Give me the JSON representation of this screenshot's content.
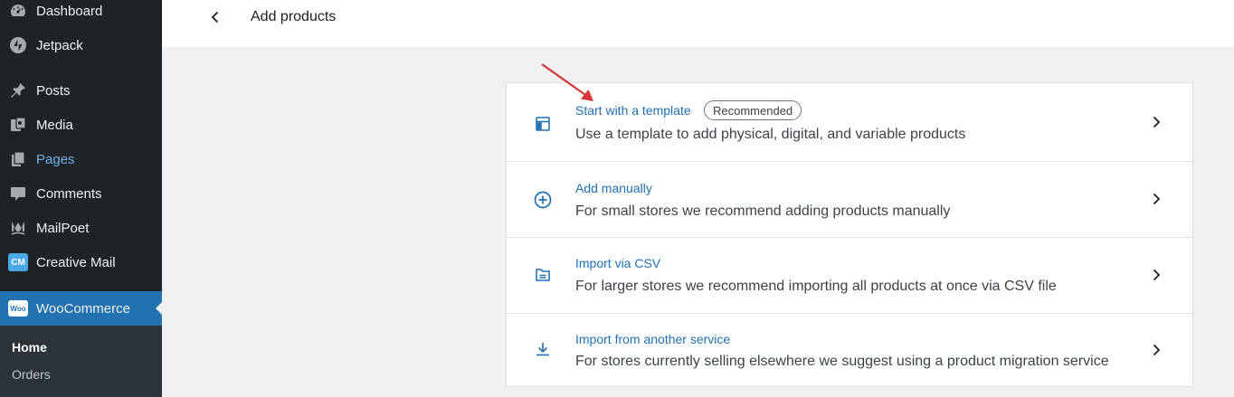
{
  "sidebar": {
    "items": [
      {
        "label": "Dashboard",
        "icon": "dashboard-icon"
      },
      {
        "label": "Jetpack",
        "icon": "jetpack-icon"
      },
      {
        "label": "Posts",
        "icon": "pin-icon"
      },
      {
        "label": "Media",
        "icon": "media-icon"
      },
      {
        "label": "Pages",
        "icon": "pages-icon"
      },
      {
        "label": "Comments",
        "icon": "comment-icon"
      },
      {
        "label": "MailPoet",
        "icon": "mailpoet-icon"
      },
      {
        "label": "Creative Mail",
        "icon": "creative-mail-icon",
        "badge": "CM"
      },
      {
        "label": "WooCommerce",
        "icon": "woocommerce-icon",
        "badge": "Woo"
      }
    ],
    "submenu": [
      {
        "label": "Home"
      },
      {
        "label": "Orders"
      }
    ]
  },
  "header": {
    "title": "Add products"
  },
  "options": [
    {
      "title": "Start with a template",
      "badge": "Recommended",
      "description": "Use a template to add physical, digital, and variable products",
      "icon": "layout-template-icon"
    },
    {
      "title": "Add manually",
      "description": "For small stores we recommend adding products manually",
      "icon": "plus-circle-icon"
    },
    {
      "title": "Import via CSV",
      "description": "For larger stores we recommend importing all products at once via CSV file",
      "icon": "csv-file-icon"
    },
    {
      "title": "Import from another service",
      "description": "For stores currently selling elsewhere we suggest using a product migration service",
      "icon": "download-icon"
    }
  ],
  "colors": {
    "sidebar_bg": "#1d2327",
    "accent": "#2271b1",
    "annotation_arrow": "#d63638"
  }
}
